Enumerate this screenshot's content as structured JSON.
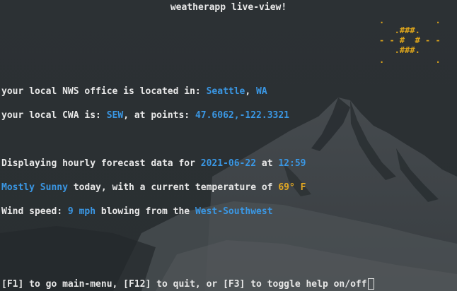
{
  "title": "weatherapp live-view!",
  "weather_art": ".          .\n   .###.\n- - #  # - -\n   .###.\n.          .",
  "office": {
    "prefix": "your local NWS office is located in: ",
    "city": "Seattle",
    "separator": ", ",
    "state": "WA"
  },
  "cwa": {
    "prefix": "your local CWA is: ",
    "code": "SEW",
    "middle": ", at points: ",
    "points": "47.6062,-122.3321"
  },
  "forecast": {
    "prefix": "Displaying hourly forecast data for ",
    "date": "2021-06-22",
    "middle": " at ",
    "time": "12:59"
  },
  "conditions": {
    "summary": "Mostly Sunny",
    "middle": " today, with a current temperature of ",
    "temperature": "69° F"
  },
  "wind": {
    "prefix": "Wind speed: ",
    "speed": "9 mph",
    "middle": " blowing from the ",
    "direction": "West-Southwest"
  },
  "help_text": "[F1] to go main-menu, [F12] to quit, or [F3] to toggle help on/off",
  "colors": {
    "background": "#2b3033",
    "text": "#e8e8e8",
    "highlight_blue": "#3a97e4",
    "highlight_yellow": "#e3a823",
    "art": "#d9a21c"
  }
}
